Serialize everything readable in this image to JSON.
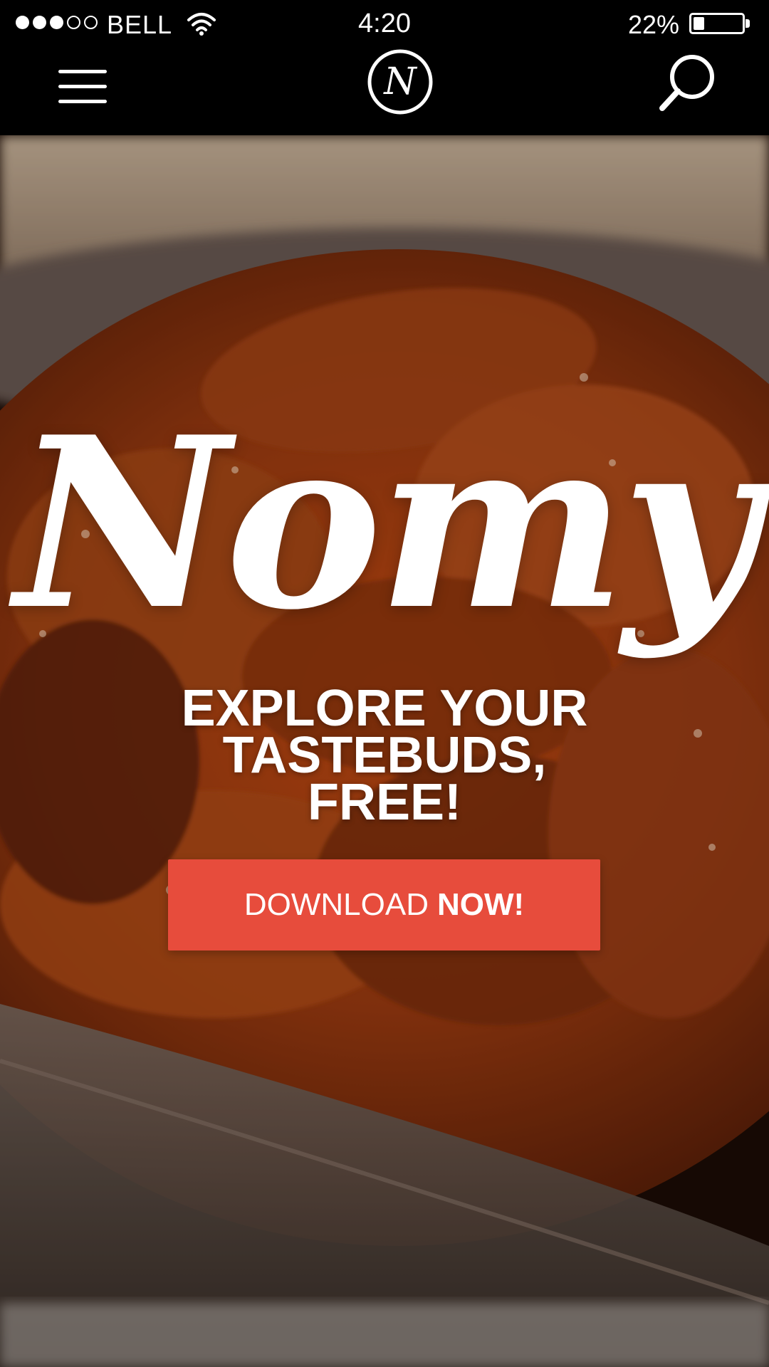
{
  "status_bar": {
    "carrier": "BELL",
    "time": "4:20",
    "battery_percent": "22%",
    "battery_level": 0.22,
    "signal_bars_filled": 3,
    "signal_bars_total": 5
  },
  "nav": {
    "menu_icon": "hamburger-menu-icon",
    "logo_letter": "N",
    "search_icon": "search-icon"
  },
  "hero": {
    "brand": "Nomy",
    "tagline_lines": [
      "EXPLORE YOUR",
      "TASTEBUDS,",
      "FREE!"
    ],
    "cta_regular": "DOWNLOAD",
    "cta_bold": "NOW!"
  },
  "colors": {
    "bar_background": "#000000",
    "cta_background": "#e74c3c",
    "text": "#ffffff"
  }
}
